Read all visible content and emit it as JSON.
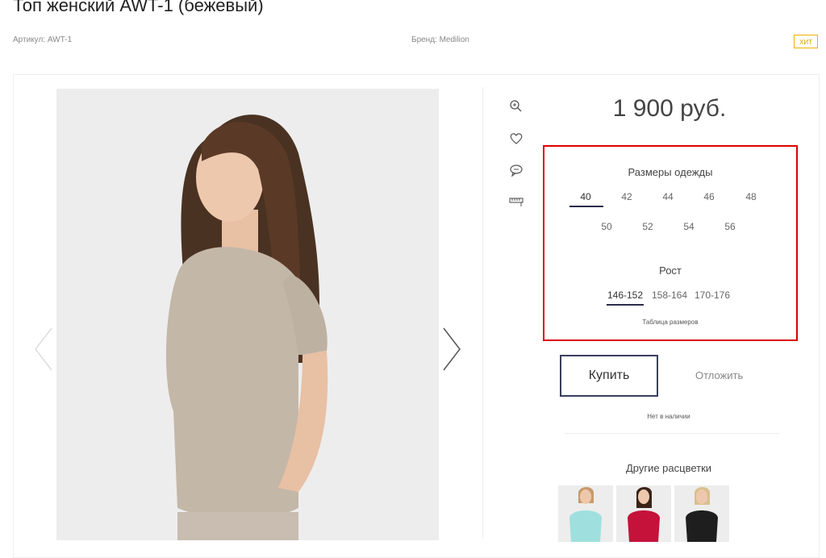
{
  "product": {
    "title": "Топ женский AWT-1 (бежевый)",
    "article": "Артикул: AWT-1",
    "brand": "Бренд: Medilion",
    "badge": "ХИТ",
    "price": "1 900 руб."
  },
  "sizes": {
    "heading": "Размеры одежды",
    "row1": [
      "40",
      "42",
      "44",
      "46",
      "48"
    ],
    "row2": [
      "50",
      "52",
      "54",
      "56"
    ],
    "selected": "40"
  },
  "height": {
    "heading": "Рост",
    "options": [
      "146-152",
      "158-164",
      "170-176"
    ],
    "selected": "146-152"
  },
  "size_table_link": "Таблица размеров",
  "actions": {
    "buy": "Купить",
    "defer": "Отложить"
  },
  "stock_status": "Нет в наличии",
  "other_colors": {
    "heading": "Другие расцветки",
    "colors": [
      "#9fe0df",
      "#c4123a",
      "#1e1e1e"
    ]
  },
  "icons": {
    "zoom": "zoom-icon",
    "favorite": "heart-icon",
    "comment": "comment-icon",
    "measure": "ruler-icon"
  }
}
